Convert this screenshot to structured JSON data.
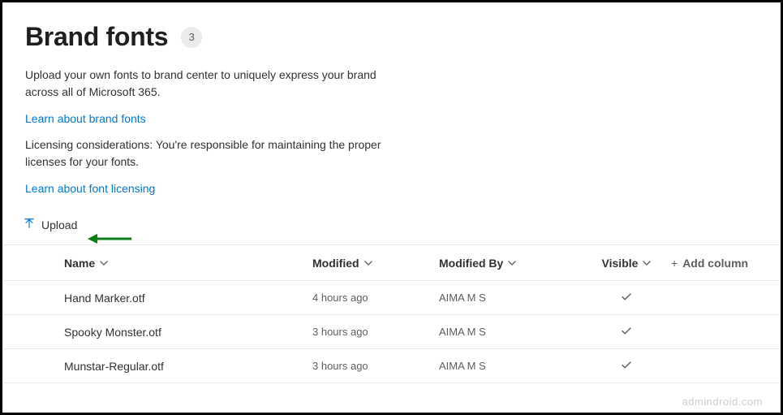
{
  "header": {
    "title": "Brand fonts",
    "count": "3",
    "intro": "Upload your own fonts to brand center to uniquely express your brand across all of Microsoft 365.",
    "learn_fonts_link": "Learn about brand fonts",
    "licensing_text": "Licensing considerations: You're responsible for maintaining the proper licenses for your fonts.",
    "learn_licensing_link": "Learn about font licensing"
  },
  "toolbar": {
    "upload_label": "Upload"
  },
  "table": {
    "columns": {
      "name": "Name",
      "modified": "Modified",
      "modified_by": "Modified By",
      "visible": "Visible",
      "add_column": "Add column"
    },
    "rows": [
      {
        "name": "Hand Marker.otf",
        "modified": "4 hours ago",
        "modified_by": "AIMA M S",
        "visible": true
      },
      {
        "name": "Spooky Monster.otf",
        "modified": "3 hours ago",
        "modified_by": "AIMA M S",
        "visible": true
      },
      {
        "name": "Munstar-Regular.otf",
        "modified": "3 hours ago",
        "modified_by": "AIMA M S",
        "visible": true
      }
    ]
  },
  "watermark": "admindroid.com"
}
